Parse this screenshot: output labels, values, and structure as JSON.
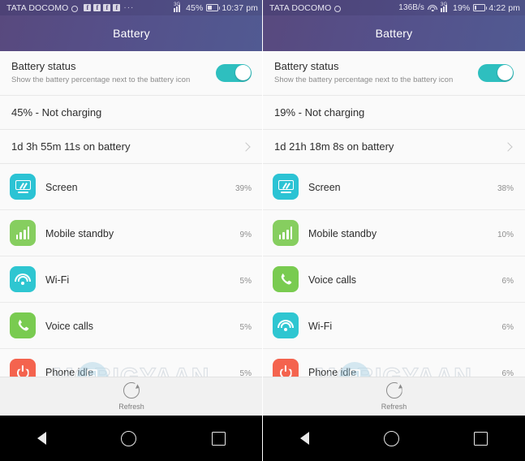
{
  "left": {
    "statusbar": {
      "carrier": "TATA DOCOMO",
      "network": "3G",
      "battery_pct": "45%",
      "time": "10:37 pm",
      "notif_icon_label": "f",
      "notif_count": 4,
      "overflow": "···"
    },
    "appbar": {
      "title": "Battery"
    },
    "battery_status": {
      "title": "Battery status",
      "subtitle": "Show the battery percentage next to the battery icon",
      "toggle_on": true
    },
    "charge_row": "45% - Not charging",
    "uptime_row": "1d 3h 55m 11s on battery",
    "usage": [
      {
        "name": "Screen",
        "pct_label": "39%",
        "pct": 39,
        "icon": "screen-icon",
        "icon_color": "#2bc3d4"
      },
      {
        "name": "Mobile standby",
        "pct_label": "9%",
        "pct": 9,
        "icon": "signal-bars-icon",
        "icon_color": "#86ce5f"
      },
      {
        "name": "Wi-Fi",
        "pct_label": "5%",
        "pct": 5,
        "icon": "wifi-icon",
        "icon_color": "#2ec6d1"
      },
      {
        "name": "Voice calls",
        "pct_label": "5%",
        "pct": 5,
        "icon": "phone-call-icon",
        "icon_color": "#79cb50"
      },
      {
        "name": "Phone idle",
        "pct_label": "5%",
        "pct": 5,
        "icon": "power-idle-icon",
        "icon_color": "#f4634e"
      }
    ],
    "refresh_label": "Refresh"
  },
  "right": {
    "statusbar": {
      "carrier": "TATA DOCOMO",
      "data_rate": "136B/s",
      "network": "3G",
      "battery_pct": "19%",
      "time": "4:22 pm"
    },
    "appbar": {
      "title": "Battery"
    },
    "battery_status": {
      "title": "Battery status",
      "subtitle": "Show the battery percentage next to the battery icon",
      "toggle_on": true
    },
    "charge_row": "19% - Not charging",
    "uptime_row": "1d 21h 18m 8s on battery",
    "usage": [
      {
        "name": "Screen",
        "pct_label": "38%",
        "pct": 38,
        "icon": "screen-icon",
        "icon_color": "#2bc3d4"
      },
      {
        "name": "Mobile standby",
        "pct_label": "10%",
        "pct": 10,
        "icon": "signal-bars-icon",
        "icon_color": "#86ce5f"
      },
      {
        "name": "Voice calls",
        "pct_label": "6%",
        "pct": 6,
        "icon": "phone-call-icon",
        "icon_color": "#79cb50"
      },
      {
        "name": "Wi-Fi",
        "pct_label": "6%",
        "pct": 6,
        "icon": "wifi-icon",
        "icon_color": "#2ec6d1"
      },
      {
        "name": "Phone idle",
        "pct_label": "6%",
        "pct": 6,
        "icon": "power-idle-icon",
        "icon_color": "#f4634e"
      }
    ],
    "refresh_label": "Refresh"
  },
  "watermark": {
    "text": "MOBIGYAAN"
  },
  "theme": {
    "accent_teal": "#2ebfbf",
    "progress_blue": "#2196c9",
    "appbar_from": "#58497e",
    "appbar_to": "#515a92"
  }
}
